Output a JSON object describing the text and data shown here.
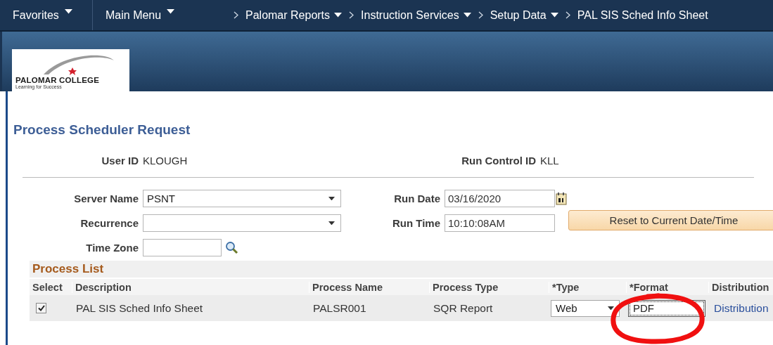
{
  "nav": {
    "menus": [
      {
        "label": "Favorites"
      },
      {
        "label": "Main Menu"
      }
    ],
    "breadcrumbs": [
      {
        "label": "Palomar Reports",
        "dropdown": true
      },
      {
        "label": "Instruction Services",
        "dropdown": true
      },
      {
        "label": "Setup Data",
        "dropdown": true
      },
      {
        "label": "PAL SIS Sched Info Sheet",
        "dropdown": false
      }
    ]
  },
  "logo": {
    "name": "PALOMAR COLLEGE",
    "tagline": "Learning for Success"
  },
  "page_title": "Process Scheduler Request",
  "user_id": {
    "label": "User ID",
    "value": "KLOUGH"
  },
  "run_control_id": {
    "label": "Run Control ID",
    "value": "KLL"
  },
  "server_name": {
    "label": "Server Name",
    "value": "PSNT"
  },
  "recurrence": {
    "label": "Recurrence"
  },
  "time_zone": {
    "label": "Time Zone"
  },
  "run_date": {
    "label": "Run Date",
    "value": "03/16/2020"
  },
  "run_time": {
    "label": "Run Time",
    "value": "10:10:08AM"
  },
  "reset_button": "Reset to Current Date/Time",
  "process_list": {
    "title": "Process List",
    "columns": [
      "Select",
      "Description",
      "Process Name",
      "Process Type",
      "*Type",
      "*Format",
      "Distribution"
    ],
    "rows": [
      {
        "checked": true,
        "description": "PAL SIS Sched Info Sheet",
        "process_name": "PALSR001",
        "process_type": "SQR Report",
        "type": "Web",
        "format": "PDF",
        "distribution": "Distribution"
      }
    ]
  },
  "annotation": {
    "kind": "circle"
  }
}
